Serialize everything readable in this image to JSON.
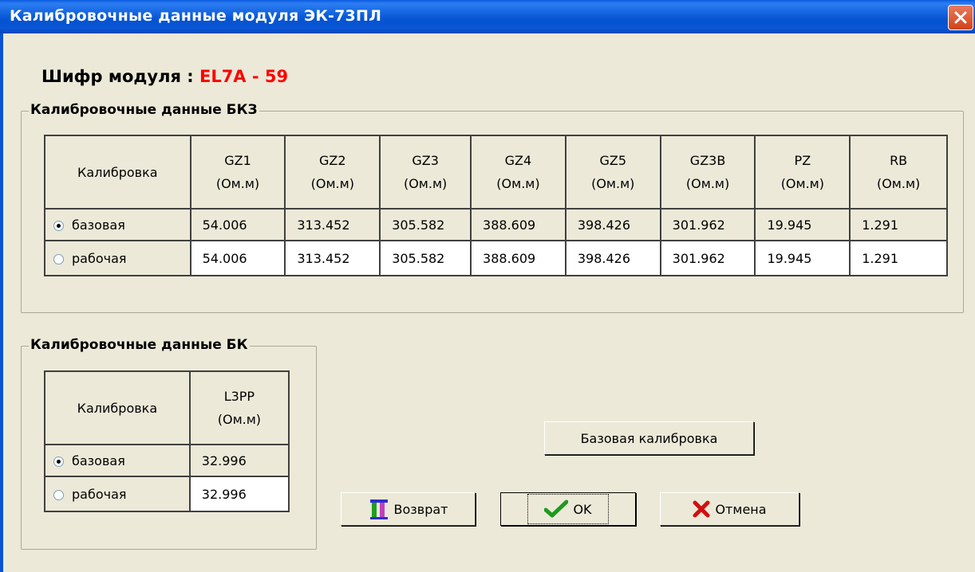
{
  "window": {
    "title": "Калибровочные данные модуля ЭК-73ПЛ"
  },
  "module_code": {
    "label": "Шифр модуля :",
    "value": "EL7A - 59"
  },
  "bkz": {
    "legend": "Калибровочные данные БКЗ",
    "header_calib": "Калибровка",
    "columns": [
      {
        "name": "GZ1",
        "unit": "(Ом.м)"
      },
      {
        "name": "GZ2",
        "unit": "(Ом.м)"
      },
      {
        "name": "GZ3",
        "unit": "(Ом.м)"
      },
      {
        "name": "GZ4",
        "unit": "(Ом.м)"
      },
      {
        "name": "GZ5",
        "unit": "(Ом.м)"
      },
      {
        "name": "GZ3B",
        "unit": "(Ом.м)"
      },
      {
        "name": "PZ",
        "unit": "(Ом.м)"
      },
      {
        "name": "RB",
        "unit": "(Ом.м)"
      }
    ],
    "rows": [
      {
        "label": "базовая",
        "selected": true,
        "values": [
          "54.006",
          "313.452",
          "305.582",
          "388.609",
          "398.426",
          "301.962",
          "19.945",
          "1.291"
        ]
      },
      {
        "label": "рабочая",
        "selected": false,
        "values": [
          "54.006",
          "313.452",
          "305.582",
          "388.609",
          "398.426",
          "301.962",
          "19.945",
          "1.291"
        ]
      }
    ]
  },
  "bk": {
    "legend": "Калибровочные данные БК",
    "header_calib": "Калибровка",
    "columns": [
      {
        "name": "L3PP",
        "unit": "(Ом.м)"
      }
    ],
    "rows": [
      {
        "label": "базовая",
        "selected": true,
        "values": [
          "32.996"
        ]
      },
      {
        "label": "рабочая",
        "selected": false,
        "values": [
          "32.996"
        ]
      }
    ]
  },
  "buttons": {
    "base_calibration": "Базовая калибровка",
    "return": "Возврат",
    "ok": "OK",
    "cancel": "Отмена"
  },
  "icons": {
    "close": "close-icon",
    "return": "exit-door-icon",
    "ok": "checkmark-icon",
    "cancel": "red-x-icon"
  }
}
